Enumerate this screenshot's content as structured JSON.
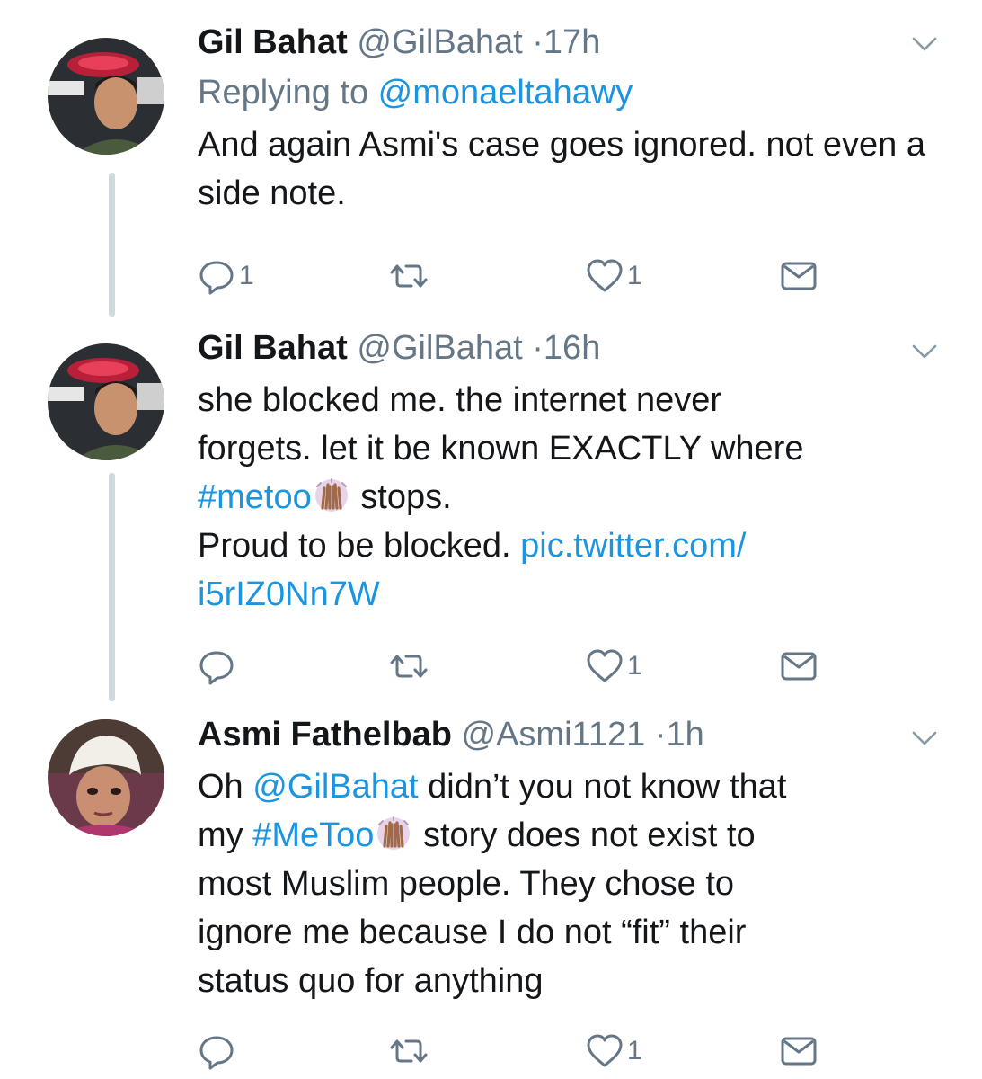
{
  "tweets": [
    {
      "name": "Gil Bahat",
      "handle": "@GilBahat",
      "separator": "·",
      "time": "17h",
      "reply_prefix": "Replying to ",
      "reply_handle": "@monaeltahawy",
      "text": "And again Asmi's case goes ignored. not even a side note.",
      "reply_count": "1",
      "retweet_count": "",
      "like_count": "1"
    },
    {
      "name": "Gil Bahat",
      "handle": "@GilBahat",
      "separator": "·",
      "time": "16h",
      "text_line1": "she blocked me. the internet never",
      "text_line2": "forgets. let it be known EXACTLY where",
      "hashtag": "#metoo",
      "text_after_hashtag": " stops.",
      "text_line4": "Proud to be blocked. ",
      "pic_link_1": "pic.twitter.com/",
      "pic_link_2": "i5rIZ0Nn7W",
      "reply_count": "",
      "retweet_count": "",
      "like_count": "1"
    },
    {
      "name": "Asmi Fathelbab",
      "handle": "@Asmi1121",
      "separator": "·",
      "time": "1h",
      "text_1": "Oh ",
      "mention": "@GilBahat",
      "text_2": " didn’t you not know that",
      "text_3": "my ",
      "hashtag": "#MeToo",
      "text_4": " story does not exist to",
      "text_5": "most Muslim people. They chose to",
      "text_6": "ignore me because I do not “fit” their",
      "text_7": "status quo for anything",
      "reply_count": "",
      "retweet_count": "",
      "like_count": "1"
    }
  ],
  "icons": {
    "reply": "reply-icon",
    "retweet": "retweet-icon",
    "like": "heart-icon",
    "dm": "envelope-icon",
    "menu": "chevron-down-icon",
    "metoo": "raised-hands-emoji"
  },
  "colors": {
    "link": "#1b95e0",
    "secondary": "#657786",
    "thread_line": "#cfd9de"
  }
}
